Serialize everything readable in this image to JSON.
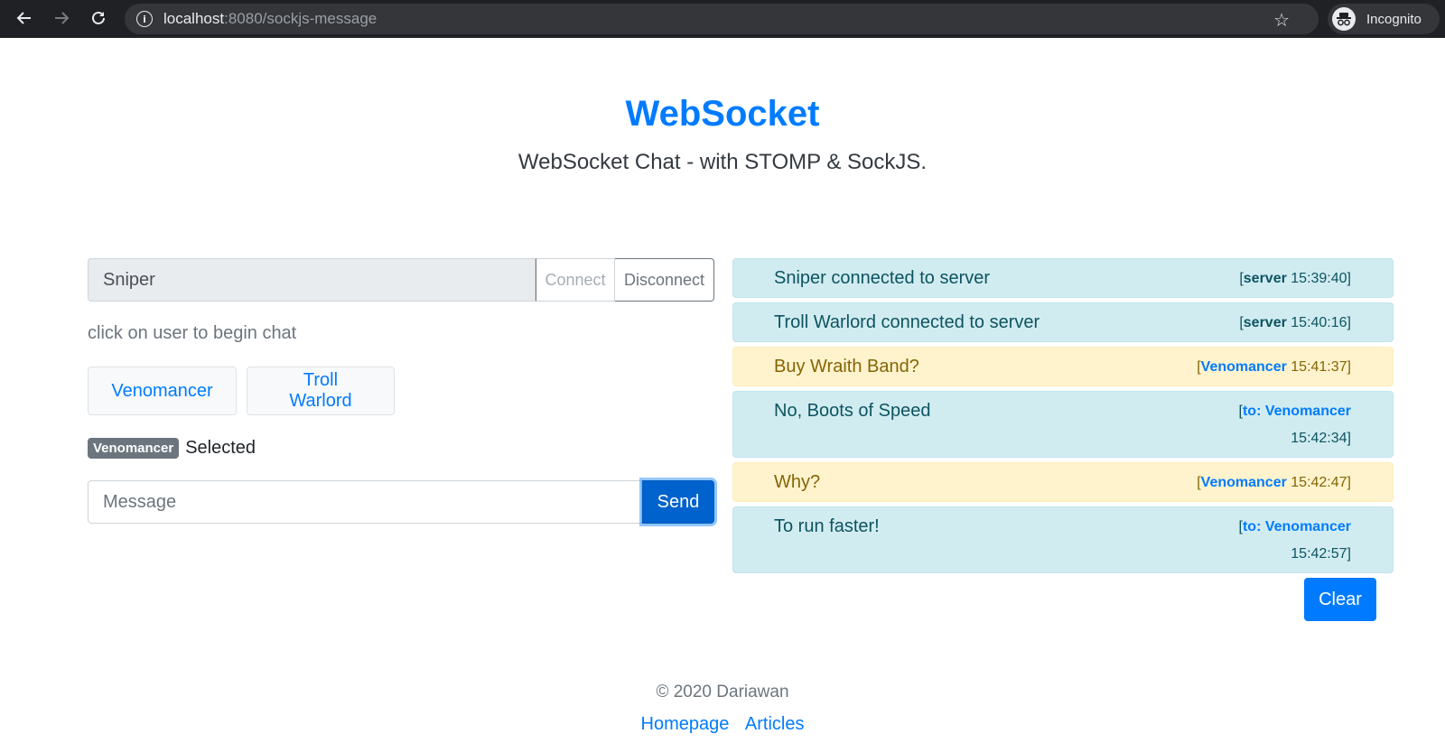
{
  "browser": {
    "url_host": "localhost",
    "url_rest": ":8080/sockjs-message",
    "profile_label": "Incognito",
    "icons": {
      "back": "arrow-left-icon",
      "forward": "arrow-right-icon",
      "reload": "reload-icon",
      "info": "info-icon",
      "star": "star-icon",
      "incognito": "incognito-icon"
    }
  },
  "header": {
    "title": "WebSocket",
    "subtitle": "WebSocket Chat - with STOMP & SockJS."
  },
  "connection": {
    "username_value": "Sniper",
    "connect_label": "Connect",
    "disconnect_label": "Disconnect"
  },
  "users": {
    "hint": "click on user to begin chat",
    "list": [
      "Venomancer",
      "Troll Warlord"
    ],
    "selected_badge": "Venomancer",
    "selected_label": "Selected"
  },
  "composer": {
    "placeholder": "Message",
    "value": "",
    "send_label": "Send"
  },
  "messages": [
    {
      "text": "Sniper connected to server",
      "who": "server",
      "time": "15:39:40",
      "type": "info"
    },
    {
      "text": "Troll Warlord connected to server",
      "who": "server",
      "time": "15:40:16",
      "type": "info"
    },
    {
      "text": "Buy Wraith Band?",
      "who": "Venomancer",
      "time": "15:41:37",
      "type": "warning"
    },
    {
      "text": "No, Boots of Speed",
      "who": "to: Venomancer",
      "time": "15:42:34",
      "type": "info"
    },
    {
      "text": "Why?",
      "who": "Venomancer",
      "time": "15:42:47",
      "type": "warning"
    },
    {
      "text": "To run faster!",
      "who": "to: Venomancer",
      "time": "15:42:57",
      "type": "info"
    }
  ],
  "clear_label": "Clear",
  "footer": {
    "copyright": "© 2020 Dariawan",
    "links": [
      "Homepage",
      "Articles"
    ]
  },
  "colors": {
    "primary": "#007bff",
    "info_bg": "#d1ecf1",
    "warning_bg": "#fff3cd",
    "badge_bg": "#6c757d"
  }
}
